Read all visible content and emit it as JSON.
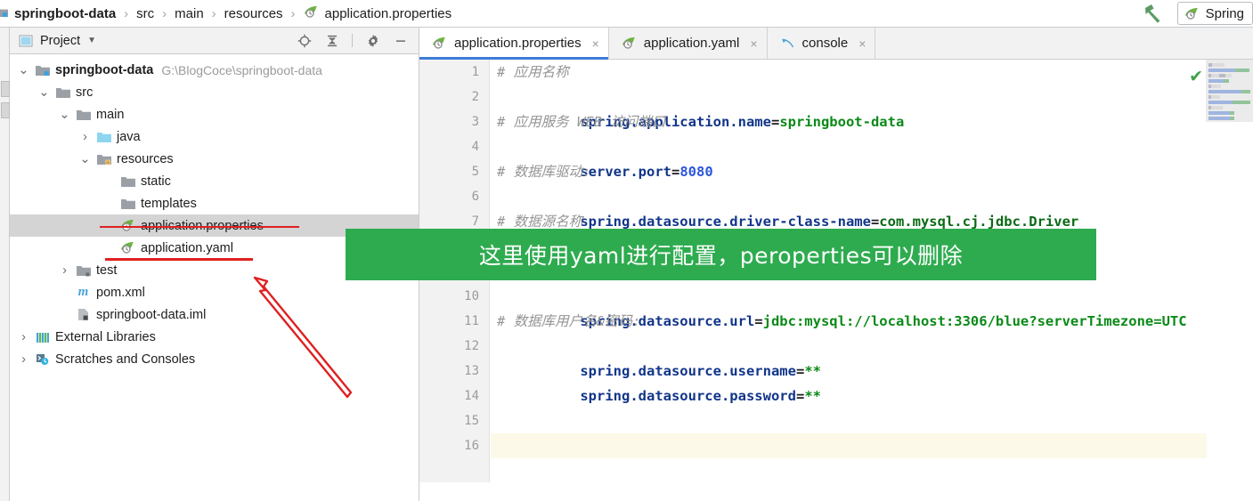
{
  "breadcrumb": {
    "items": [
      {
        "label": "springboot-data",
        "icon": "module-icon",
        "bold": true
      },
      {
        "label": "src",
        "icon": "",
        "bold": false
      },
      {
        "label": "main",
        "icon": "",
        "bold": false
      },
      {
        "label": "resources",
        "icon": "",
        "bold": false
      },
      {
        "label": "application.properties",
        "icon": "spring-leaf-icon",
        "bold": false
      }
    ],
    "separator": "›",
    "right": {
      "arrow_icon": "green-up-arrow-icon",
      "chip_label": "Spring",
      "chip_icon": "spring-leaf-icon"
    }
  },
  "project_panel": {
    "title": "Project",
    "title_icon": "project-window-icon",
    "dropdown_icon": "chevron-down-icon",
    "tools": [
      {
        "name": "locate-icon",
        "glyph": "⊕"
      },
      {
        "name": "collapse-all-icon",
        "glyph": "≡"
      },
      {
        "name": "settings-gear-icon",
        "glyph": "⚙"
      },
      {
        "name": "hide-panel-icon",
        "glyph": "—"
      }
    ],
    "tree": [
      {
        "label": "springboot-data",
        "sub": "G:\\BlogCoce\\springboot-data",
        "icon": "module-icon",
        "indent": 0,
        "arrow": "expanded",
        "bold": true,
        "selected": false
      },
      {
        "label": "src",
        "sub": "",
        "icon": "folder-icon",
        "indent": 1,
        "arrow": "expanded",
        "bold": false,
        "selected": false
      },
      {
        "label": "main",
        "sub": "",
        "icon": "folder-icon",
        "indent": 2,
        "arrow": "expanded",
        "bold": false,
        "selected": false
      },
      {
        "label": "java",
        "sub": "",
        "icon": "source-folder-icon",
        "indent": 3,
        "arrow": "collapsed",
        "bold": false,
        "selected": false
      },
      {
        "label": "resources",
        "sub": "",
        "icon": "resource-folder-icon",
        "indent": 3,
        "arrow": "expanded",
        "bold": false,
        "selected": false
      },
      {
        "label": "static",
        "sub": "",
        "icon": "folder-icon",
        "indent": 4,
        "arrow": "none",
        "bold": false,
        "selected": false
      },
      {
        "label": "templates",
        "sub": "",
        "icon": "folder-icon",
        "indent": 4,
        "arrow": "none",
        "bold": false,
        "selected": false
      },
      {
        "label": "application.properties",
        "sub": "",
        "icon": "spring-leaf-icon",
        "indent": 4,
        "arrow": "none",
        "bold": false,
        "selected": true
      },
      {
        "label": "application.yaml",
        "sub": "",
        "icon": "spring-leaf-icon",
        "indent": 4,
        "arrow": "none",
        "bold": false,
        "selected": false
      },
      {
        "label": "test",
        "sub": "",
        "icon": "folder-icon",
        "indent": 2,
        "arrow": "collapsed",
        "bold": false,
        "selected": false
      },
      {
        "label": "pom.xml",
        "sub": "",
        "icon": "maven-icon",
        "indent": 2,
        "arrow": "none",
        "bold": false,
        "selected": false
      },
      {
        "label": "springboot-data.iml",
        "sub": "",
        "icon": "iml-icon",
        "indent": 2,
        "arrow": "none",
        "bold": false,
        "selected": false
      },
      {
        "label": "External Libraries",
        "sub": "",
        "icon": "libraries-icon",
        "indent": 0,
        "arrow": "collapsed",
        "bold": false,
        "selected": false
      },
      {
        "label": "Scratches and Consoles",
        "sub": "",
        "icon": "scratches-icon",
        "indent": 0,
        "arrow": "collapsed",
        "bold": false,
        "selected": false
      }
    ]
  },
  "editor": {
    "tabs": [
      {
        "label": "application.properties",
        "icon": "spring-leaf-icon",
        "active": true,
        "close": "×"
      },
      {
        "label": "application.yaml",
        "icon": "spring-leaf-icon",
        "active": false,
        "close": "×"
      },
      {
        "label": "console",
        "icon": "console-query-icon",
        "active": false,
        "close": "×"
      }
    ],
    "inspection_status": "✔",
    "caret_line": 16,
    "line_numbers": [
      "1",
      "2",
      "3",
      "4",
      "5",
      "6",
      "7",
      "8",
      "9",
      "10",
      "11",
      "12",
      "13",
      "14",
      "15",
      "16"
    ],
    "lines": [
      {
        "n": 1,
        "type": "comment",
        "text": "# 应用名称"
      },
      {
        "n": 2,
        "type": "prop",
        "key": "spring.application.name",
        "value": "springboot-data",
        "value_style": "green"
      },
      {
        "n": 3,
        "type": "comment",
        "text": "# 应用服务 WEB 访问端口"
      },
      {
        "n": 4,
        "type": "prop",
        "key": "server.port",
        "value": "8080",
        "value_style": "number"
      },
      {
        "n": 5,
        "type": "comment",
        "text": "# 数据库驱动:"
      },
      {
        "n": 6,
        "type": "prop",
        "key": "spring.datasource.driver-class-name",
        "value": "com.mysql.cj.jdbc.Driver",
        "value_style": "green-dark"
      },
      {
        "n": 7,
        "type": "comment",
        "text": "# 数据源名称"
      },
      {
        "n": 8,
        "type": "hidden",
        "text": ""
      },
      {
        "n": 9,
        "type": "hidden",
        "text": ""
      },
      {
        "n": 10,
        "type": "prop",
        "key": "spring.datasource.url",
        "value": "jdbc:mysql://localhost:3306/blue?serverTimezone=UTC",
        "value_style": "green"
      },
      {
        "n": 11,
        "type": "comment",
        "text": "# 数据库用户名&密码:"
      },
      {
        "n": 12,
        "type": "prop",
        "key": "spring.datasource.username",
        "value": "**",
        "value_style": "green"
      },
      {
        "n": 13,
        "type": "prop",
        "key": "spring.datasource.password",
        "value": "**",
        "value_style": "green"
      },
      {
        "n": 14,
        "type": "blank",
        "text": ""
      },
      {
        "n": 15,
        "type": "blank",
        "text": ""
      },
      {
        "n": 16,
        "type": "blank",
        "text": ""
      }
    ]
  },
  "annotations": {
    "banner_text": "这里使用yaml进行配置，peroperties可以删除",
    "banner_color": "#2eab4f",
    "banner_text_color": "#ffffff",
    "marker_color": "#e02020",
    "strike_target": "application.properties",
    "underline_target": "application.yaml",
    "arrow": "red-arrow-pointing-up-left"
  },
  "colors": {
    "accent_tab": "#3d7dd8",
    "key": "#12358a",
    "value": "#0b8a18",
    "number": "#2a55dd",
    "comment": "#949494",
    "selection": "#d4d4d4",
    "caret_line": "#fcf9e8"
  }
}
